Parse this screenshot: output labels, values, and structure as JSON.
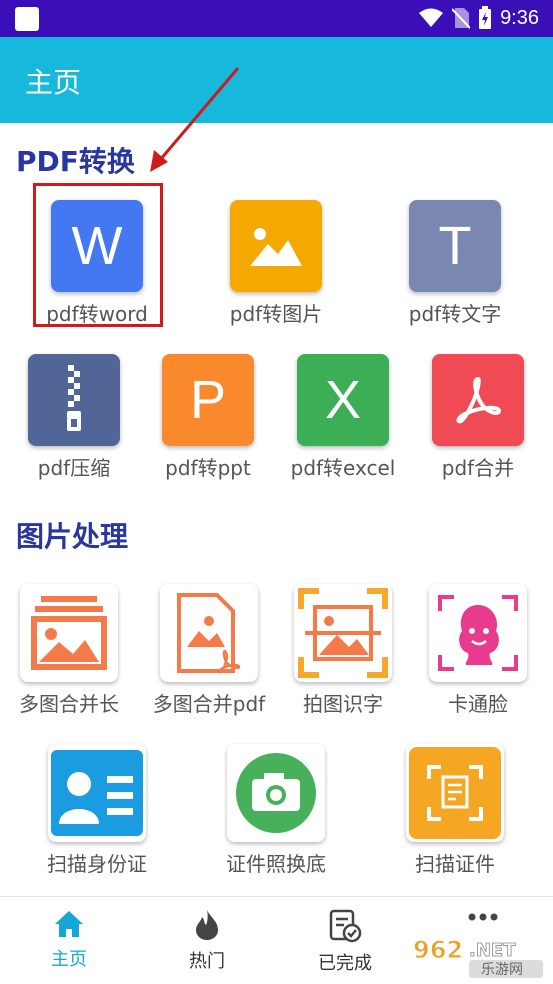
{
  "status_bar": {
    "time": "9:36"
  },
  "app_bar": {
    "title": "主页"
  },
  "sections": {
    "pdf": {
      "title": "PDF转换",
      "items": [
        {
          "label": "pdf转word",
          "icon_text": "W",
          "color": "#4477f2"
        },
        {
          "label": "pdf转图片",
          "icon": "image-icon",
          "color": "#f4a800"
        },
        {
          "label": "pdf转文字",
          "icon_text": "T",
          "color": "#7a87b0"
        },
        {
          "label": "pdf压缩",
          "icon": "zip-icon",
          "color": "#516597"
        },
        {
          "label": "pdf转ppt",
          "icon_text": "P",
          "color": "#f9892c"
        },
        {
          "label": "pdf转excel",
          "icon_text": "X",
          "color": "#3bae56"
        },
        {
          "label": "pdf合并",
          "icon": "acrobat-icon",
          "color": "#f04b54"
        }
      ]
    },
    "image": {
      "title": "图片处理",
      "items": [
        {
          "label": "多图合并长",
          "icon": "long-image-merge-icon"
        },
        {
          "label": "多图合并pdf",
          "icon": "image-to-pdf-icon"
        },
        {
          "label": "拍图识字",
          "icon": "scan-image-text-icon"
        },
        {
          "label": "卡通脸",
          "icon": "cartoon-face-icon"
        },
        {
          "label": "扫描身份证",
          "icon": "id-card-icon"
        },
        {
          "label": "证件照换底",
          "icon": "camera-icon"
        },
        {
          "label": "扫描证件",
          "icon": "scan-document-icon"
        }
      ]
    }
  },
  "bottom_nav": {
    "items": [
      {
        "label": "主页",
        "icon": "home-icon",
        "active": true
      },
      {
        "label": "热门",
        "icon": "flame-icon"
      },
      {
        "label": "已完成",
        "icon": "done-list-icon"
      },
      {
        "label": "",
        "icon": "more-icon"
      }
    ]
  },
  "watermark": {
    "text": "962.NET",
    "subtext": "乐游网"
  },
  "colors": {
    "status_bar": "#3a0fb8",
    "app_bar": "#16b8dc",
    "section_title": "#2a36a0",
    "accent": "#16a6d6",
    "highlight": "#d11a1a"
  }
}
